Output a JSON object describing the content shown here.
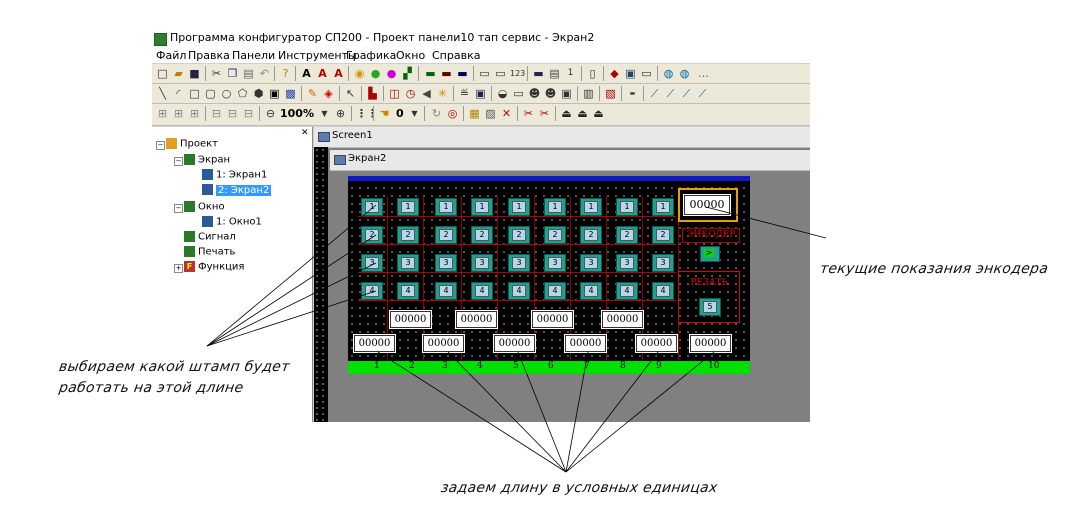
{
  "window": {
    "title": "Программа конфигуратор СП200 - Проект панели10 тап сервис - Экран2"
  },
  "menu": [
    "Файл",
    "Правка",
    "Панели",
    "Инструменты",
    "Графика",
    "Окно",
    "Справка"
  ],
  "toolbar3": {
    "zoom": "100%",
    "value": "0"
  },
  "tree": {
    "root": "Проект",
    "screens_group": "Экран",
    "screen1": "1: Экран1",
    "screen2": "2: Экран2",
    "window_group": "Окно",
    "window1": "1: Окно1",
    "signal": "Сигнал",
    "print": "Печать",
    "function": "Функция",
    "function_icon": "F"
  },
  "tabs": {
    "doc1": "Screen1",
    "doc2": "Экран2"
  },
  "panel": {
    "rows": [
      [
        "1",
        "1",
        "1",
        "1",
        "1",
        "1",
        "1",
        "1",
        "1"
      ],
      [
        "2",
        "2",
        "2",
        "2",
        "2",
        "2",
        "2",
        "2",
        "2"
      ],
      [
        "3",
        "3",
        "3",
        "3",
        "3",
        "3",
        "3",
        "3",
        "3"
      ],
      [
        "4",
        "4",
        "4",
        "4",
        "4",
        "4",
        "4",
        "4",
        "4"
      ]
    ],
    "encoder_value": "00000",
    "encoder_label": "ЭНКОДЕР",
    "go_arrow": ">",
    "cut_label": "РЕЗАТЬ",
    "cut_number": "5",
    "length_top": [
      "00000",
      "00000",
      "00000",
      "00000"
    ],
    "length_bottom": [
      "00000",
      "00000",
      "00000",
      "00000",
      "00000",
      "00000"
    ],
    "column_labels": [
      "1",
      "2",
      "3",
      "4",
      "5",
      "6",
      "7",
      "8",
      "9",
      "10"
    ]
  },
  "annotations": {
    "encoder_note": "текущие показания энкодера",
    "stamp_note_line1": "выбираем какой штамп будет",
    "stamp_note_line2": "работать на этой длине",
    "length_note": "задаем длину в условных единицах"
  },
  "colors": {
    "panel_top_bar": "#1018c8",
    "panel_bottom_bar": "#00e000",
    "stamp_button": "#21a090",
    "frame_red": "#b00000",
    "encoder_frame": "#e8a000"
  }
}
